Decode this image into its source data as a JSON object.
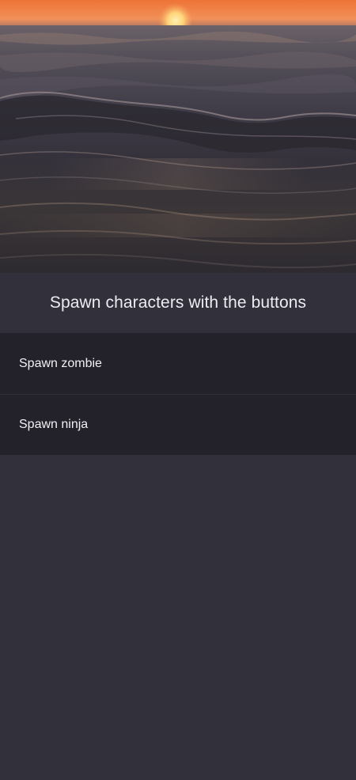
{
  "hero": {
    "image": "ocean-sunset-waves"
  },
  "heading": "Spawn characters with the buttons",
  "buttons": [
    {
      "label": "Spawn zombie"
    },
    {
      "label": "Spawn ninja"
    }
  ],
  "colors": {
    "background": "#32303b",
    "button_background": "#23222a",
    "text": "#f1f1f4",
    "sun": "#ffd57a",
    "sky": "#f07a3c"
  }
}
